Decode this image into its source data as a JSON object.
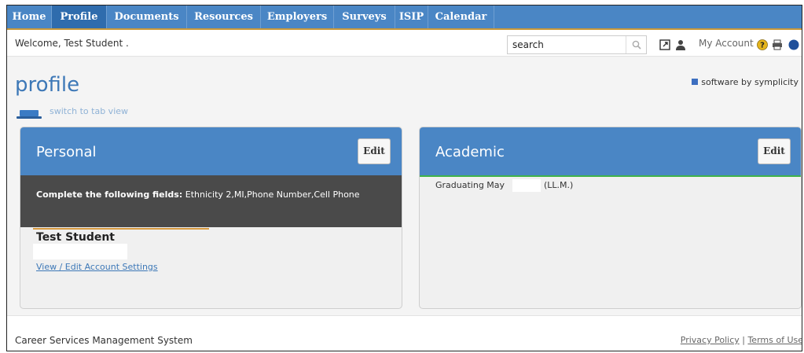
{
  "nav": {
    "items": [
      "Home",
      "Profile",
      "Documents",
      "Resources",
      "Employers",
      "Surveys",
      "ISIP",
      "Calendar"
    ],
    "active": "Profile"
  },
  "header": {
    "welcome": "Welcome, Test Student .",
    "search": {
      "value": "search",
      "placeholder": "search"
    },
    "my_account": "My Account"
  },
  "page": {
    "title": "profile",
    "switch_view": "switch to tab view",
    "brand": "software by symplicity"
  },
  "personal": {
    "title": "Personal",
    "edit_label": "Edit",
    "notice_bold": "Complete the following fields:",
    "notice_text": " Ethnicity 2,MI,Phone Number,Cell Phone",
    "name": "Test Student",
    "account_link": "View / Edit Account Settings"
  },
  "academic": {
    "title": "Academic",
    "edit_label": "Edit",
    "graduating": "Graduating May",
    "degree": "(LL.M.)"
  },
  "footer": {
    "system": "Career Services Management System",
    "privacy": "Privacy Policy",
    "separator": " | ",
    "terms": "Terms of Use"
  },
  "colors": {
    "nav": "#4a86c5",
    "nav_active": "#2f6cad",
    "accent_orange": "#d79a3f",
    "accent_green": "#3fb34a",
    "notice_bg": "#4a4a4a"
  }
}
